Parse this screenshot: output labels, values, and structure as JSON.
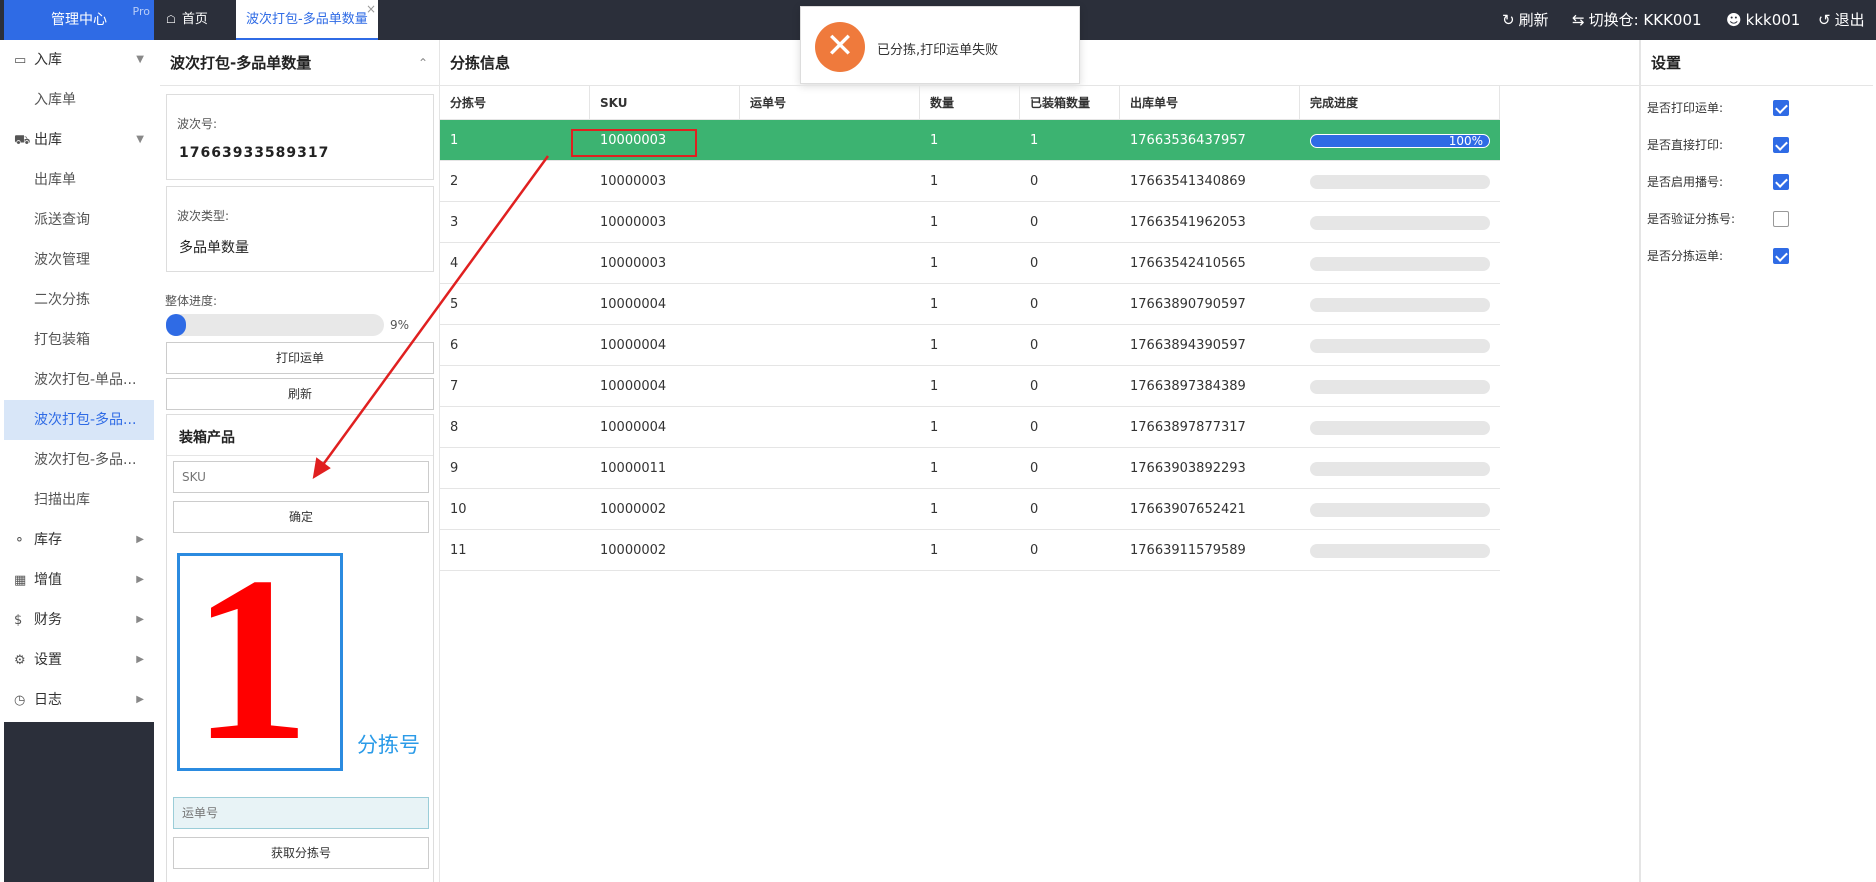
{
  "brand": {
    "title": "管理中心",
    "badge": "Pro"
  },
  "tabs": [
    {
      "label": "首页"
    },
    {
      "label": "波次打包-多品单数量"
    }
  ],
  "topbar": {
    "refresh": "刷新",
    "switch_warehouse": "切换仓: KKK001",
    "user": "kkk001",
    "logout": "退出"
  },
  "toast": {
    "message": "已分拣,打印运单失败"
  },
  "sidebar": {
    "groups": [
      {
        "label": "入库",
        "icon": "inbox-icon"
      },
      {
        "label": "出库",
        "icon": "truck-icon"
      },
      {
        "label": "库存",
        "icon": "coins-icon"
      },
      {
        "label": "增值",
        "icon": "grid-icon"
      },
      {
        "label": "财务",
        "icon": "dollar-icon"
      },
      {
        "label": "设置",
        "icon": "gears-icon"
      },
      {
        "label": "日志",
        "icon": "clock-icon"
      }
    ],
    "inbound_items": [
      "入库单"
    ],
    "outbound_items": [
      "出库单",
      "派送查询",
      "波次管理",
      "二次分拣",
      "打包装箱",
      "波次打包-单品...",
      "波次打包-多品...",
      "波次打包-多品...",
      "扫描出库"
    ]
  },
  "left_panel": {
    "title": "波次打包-多品单数量",
    "wave_no_label": "波次号:",
    "wave_no": "17663933589317",
    "wave_type_label": "波次类型:",
    "wave_type": "多品单数量",
    "progress_label": "整体进度:",
    "progress_percent": 9,
    "progress_text": "9%",
    "print_button": "打印运单",
    "refresh_button": "刷新",
    "pack_title": "装箱产品",
    "sku_placeholder": "SKU",
    "confirm_button": "确定",
    "sort_number": "1",
    "sort_number_label": "分拣号",
    "waybill_placeholder": "运单号",
    "get_sort_button": "获取分拣号"
  },
  "center": {
    "title": "分拣信息",
    "columns": [
      "分拣号",
      "SKU",
      "运单号",
      "数量",
      "已装箱数量",
      "出库单号",
      "完成进度"
    ],
    "rows": [
      {
        "sort": "1",
        "sku": "10000003",
        "waybill": "",
        "qty": "1",
        "packed": "1",
        "order": "17663536437957",
        "progress": 100,
        "progress_text": "100%"
      },
      {
        "sort": "2",
        "sku": "10000003",
        "waybill": "",
        "qty": "1",
        "packed": "0",
        "order": "17663541340869",
        "progress": 0,
        "progress_text": ""
      },
      {
        "sort": "3",
        "sku": "10000003",
        "waybill": "",
        "qty": "1",
        "packed": "0",
        "order": "17663541962053",
        "progress": 0,
        "progress_text": ""
      },
      {
        "sort": "4",
        "sku": "10000003",
        "waybill": "",
        "qty": "1",
        "packed": "0",
        "order": "17663542410565",
        "progress": 0,
        "progress_text": ""
      },
      {
        "sort": "5",
        "sku": "10000004",
        "waybill": "",
        "qty": "1",
        "packed": "0",
        "order": "17663890790597",
        "progress": 0,
        "progress_text": ""
      },
      {
        "sort": "6",
        "sku": "10000004",
        "waybill": "",
        "qty": "1",
        "packed": "0",
        "order": "17663894390597",
        "progress": 0,
        "progress_text": ""
      },
      {
        "sort": "7",
        "sku": "10000004",
        "waybill": "",
        "qty": "1",
        "packed": "0",
        "order": "17663897384389",
        "progress": 0,
        "progress_text": ""
      },
      {
        "sort": "8",
        "sku": "10000004",
        "waybill": "",
        "qty": "1",
        "packed": "0",
        "order": "17663897877317",
        "progress": 0,
        "progress_text": ""
      },
      {
        "sort": "9",
        "sku": "10000011",
        "waybill": "",
        "qty": "1",
        "packed": "0",
        "order": "17663903892293",
        "progress": 0,
        "progress_text": ""
      },
      {
        "sort": "10",
        "sku": "10000002",
        "waybill": "",
        "qty": "1",
        "packed": "0",
        "order": "17663907652421",
        "progress": 0,
        "progress_text": ""
      },
      {
        "sort": "11",
        "sku": "10000002",
        "waybill": "",
        "qty": "1",
        "packed": "0",
        "order": "17663911579589",
        "progress": 0,
        "progress_text": ""
      }
    ]
  },
  "settings": {
    "title": "设置",
    "items": [
      {
        "label": "是否打印运单:",
        "checked": true
      },
      {
        "label": "是否直接打印:",
        "checked": true
      },
      {
        "label": "是否启用播号:",
        "checked": true
      },
      {
        "label": "是否验证分拣号:",
        "checked": false
      },
      {
        "label": "是否分拣运单:",
        "checked": true
      }
    ]
  },
  "colors": {
    "accent": "#2f6be5",
    "highlight_row": "#3cb371",
    "error": "#ef7a3c",
    "sort_number": "#ff0000"
  }
}
